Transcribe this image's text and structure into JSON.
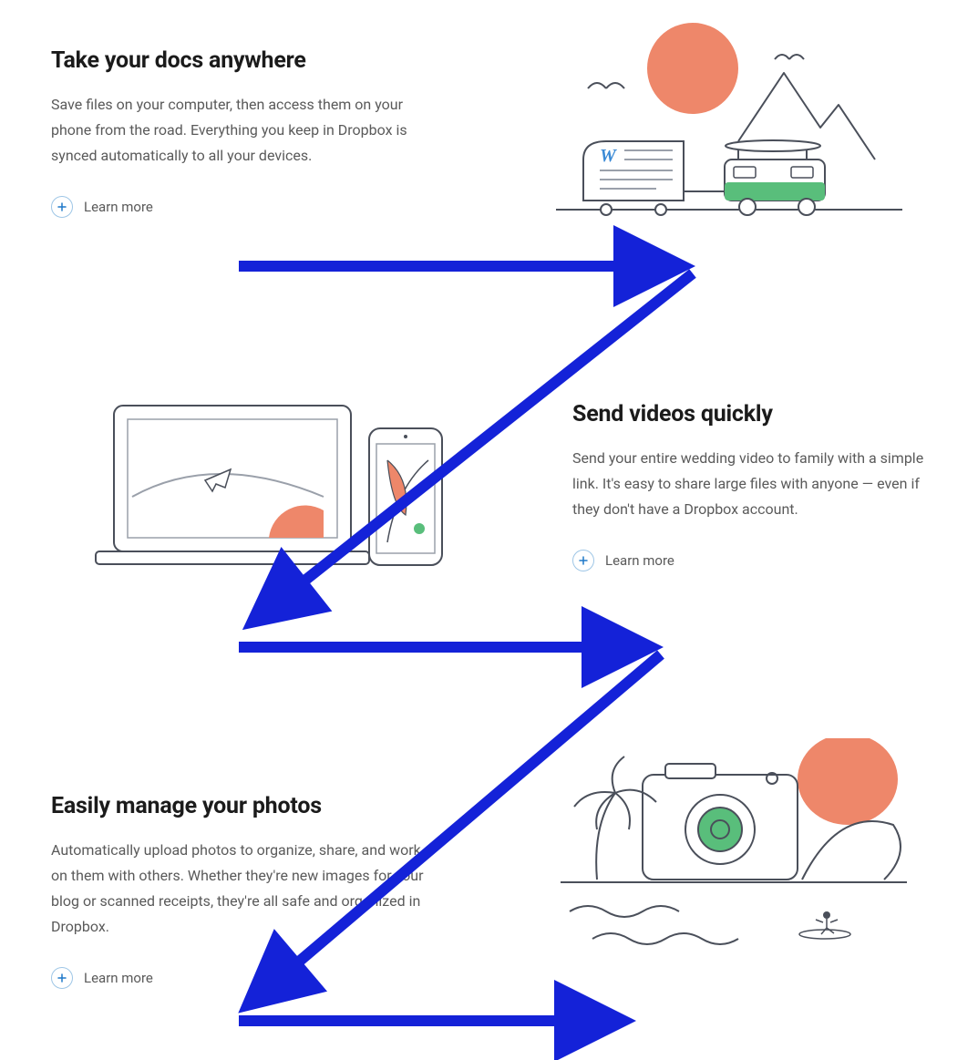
{
  "colors": {
    "arrow": "#1422d8",
    "accent_peach": "#ee876a",
    "accent_green": "#59be7b",
    "stroke": "#4a4f5a",
    "word_blue": "#3b8bd6"
  },
  "sections": [
    {
      "id": "docs",
      "title": "Take your docs anywhere",
      "desc": "Save files on your computer, then access them on your phone from the road. Everything you keep in Dropbox is synced automatically to all your devices.",
      "learn_more": "Learn more"
    },
    {
      "id": "videos",
      "title": "Send videos quickly",
      "desc": "Send your entire wedding video to family with a simple link. It's easy to share large files with anyone — even if they don't have a Dropbox account.",
      "learn_more": "Learn more"
    },
    {
      "id": "photos",
      "title": "Easily manage your photos",
      "desc": "Automatically upload photos to organize, share, and work on them with others. Whether they're new images for your blog or scanned receipts, they're all safe and organized in Dropbox.",
      "learn_more": "Learn more"
    }
  ]
}
